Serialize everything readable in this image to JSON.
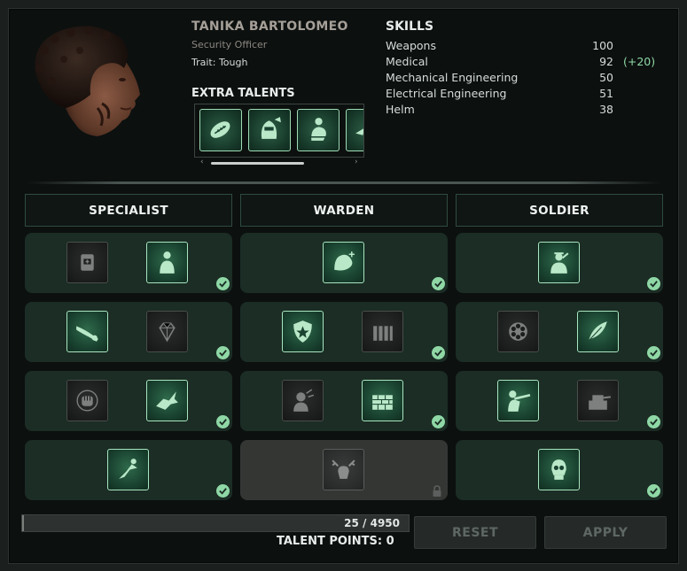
{
  "character": {
    "name": "TANIKA BARTOLOMEO",
    "job": "Security Officer",
    "trait": "Trait: Tough"
  },
  "extra_talents": {
    "title": "EXTRA TALENTS",
    "icons": [
      "football-icon",
      "armored-helmet-icon",
      "crouching-figure-icon",
      "partial-icon"
    ],
    "scroll_left": "‹",
    "scroll_right": "›"
  },
  "skills": {
    "title": "SKILLS",
    "rows": [
      {
        "name": "Weapons",
        "value": "100",
        "bonus": ""
      },
      {
        "name": "Medical",
        "value": "92",
        "bonus": "(+20)"
      },
      {
        "name": "Mechanical Engineering",
        "value": "50",
        "bonus": ""
      },
      {
        "name": "Electrical Engineering",
        "value": "51",
        "bonus": ""
      },
      {
        "name": "Helm",
        "value": "38",
        "bonus": ""
      }
    ]
  },
  "trees": [
    {
      "title": "SPECIALIST",
      "rows": [
        {
          "talents": [
            {
              "icon": "armor-vest-icon",
              "unlocked": false
            },
            {
              "icon": "figure-silhouette-icon",
              "unlocked": true
            }
          ],
          "complete": true
        },
        {
          "talents": [
            {
              "icon": "diver-icon",
              "unlocked": true
            },
            {
              "icon": "gem-icon",
              "unlocked": false
            }
          ],
          "complete": true
        },
        {
          "talents": [
            {
              "icon": "fist-target-icon",
              "unlocked": false
            },
            {
              "icon": "swimming-creature-icon",
              "unlocked": true
            }
          ],
          "complete": true
        },
        {
          "talents": [
            {
              "icon": "leaping-figure-icon",
              "unlocked": true
            }
          ],
          "complete": true
        }
      ]
    },
    {
      "title": "WARDEN",
      "rows": [
        {
          "talents": [
            {
              "icon": "flexed-arm-icon",
              "unlocked": true
            }
          ],
          "complete": true
        },
        {
          "talents": [
            {
              "icon": "police-badge-icon",
              "unlocked": true
            },
            {
              "icon": "ammo-rounds-icon",
              "unlocked": false
            }
          ],
          "complete": true
        },
        {
          "talents": [
            {
              "icon": "bomb-figure-icon",
              "unlocked": false
            },
            {
              "icon": "brick-wall-icon",
              "unlocked": true
            }
          ],
          "complete": true
        },
        {
          "talents": [
            {
              "icon": "moose-head-icon",
              "unlocked": false
            }
          ],
          "complete": false,
          "locked": true
        }
      ]
    },
    {
      "title": "SOLDIER",
      "rows": [
        {
          "talents": [
            {
              "icon": "saluting-soldier-icon",
              "unlocked": true
            }
          ],
          "complete": true
        },
        {
          "talents": [
            {
              "icon": "revolver-cylinder-icon",
              "unlocked": false
            },
            {
              "icon": "feather-icon",
              "unlocked": true
            }
          ],
          "complete": true
        },
        {
          "talents": [
            {
              "icon": "rifleman-icon",
              "unlocked": true
            },
            {
              "icon": "turret-icon",
              "unlocked": false
            }
          ],
          "complete": true
        },
        {
          "talents": [
            {
              "icon": "skull-icon",
              "unlocked": true
            }
          ],
          "complete": true
        }
      ]
    }
  ],
  "progress": {
    "text": "25 / 4950",
    "current": 25,
    "max": 4950
  },
  "talent_points": "TALENT POINTS: 0",
  "buttons": {
    "reset": "RESET",
    "apply": "APPLY"
  },
  "colors": {
    "accent": "#8fd8a6",
    "cell": "#1b2d25",
    "locked_cell": "#343634"
  }
}
